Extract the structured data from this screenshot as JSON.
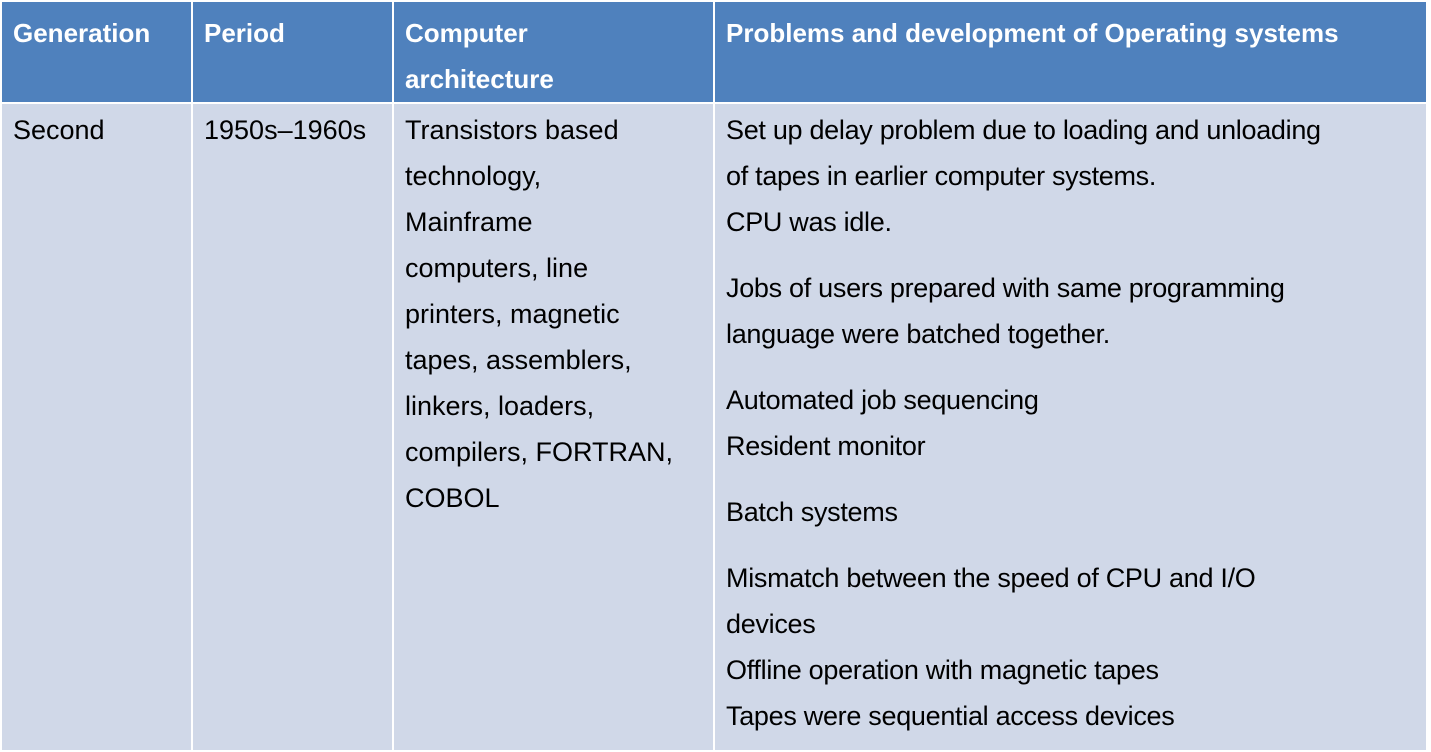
{
  "table": {
    "headers": {
      "generation": "Generation",
      "period": "Period",
      "architecture": [
        "Computer",
        "architecture"
      ],
      "problems": "Problems and development of Operating systems"
    },
    "row": {
      "generation": "Second",
      "period": "1950s–1960s",
      "architecture_lines": [
        "Transistors based",
        "technology,",
        "Mainframe",
        "computers, line",
        "printers, magnetic",
        "tapes, assemblers,",
        "linkers, loaders,",
        "compilers, FORTRAN,",
        "COBOL"
      ],
      "problems_paragraphs": [
        [
          "Set up delay problem due to loading and unloading",
          "of tapes in earlier computer systems.",
          "CPU was idle."
        ],
        [
          "Jobs of users prepared with same programming",
          "language were batched together."
        ],
        [
          "Automated job sequencing",
          "Resident monitor"
        ],
        [
          "Batch systems"
        ],
        [
          "Mismatch between the speed of CPU and I/O",
          "devices",
          "Offline operation with magnetic tapes",
          "Tapes were sequential access devices"
        ]
      ]
    }
  }
}
